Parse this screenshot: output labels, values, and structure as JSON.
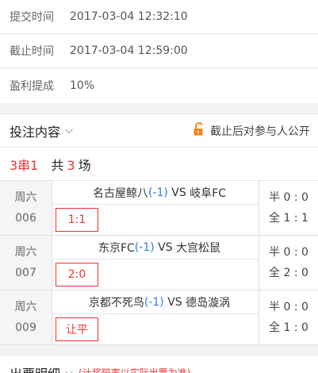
{
  "info": {
    "submit_label": "提交时间",
    "submit_value": "2017-03-04 12:32:10",
    "deadline_label": "截止时间",
    "deadline_value": "2017-03-04 12:59:00",
    "commission_label": "盈利提成",
    "commission_value": "10%"
  },
  "bet_section": {
    "title": "投注内容",
    "public_label": "截止后对参与人公开",
    "combo_type": "3串1",
    "total_prefix": "共",
    "total_count": "3",
    "total_suffix": "场"
  },
  "matches": [
    {
      "day": "周六",
      "num": "006",
      "home": "名古屋鲸八",
      "handicap": "(-1)",
      "vs": " VS ",
      "away": "岐阜FC",
      "pick": "1:1",
      "half": "半 0 : 0",
      "full": "全 1 : 1"
    },
    {
      "day": "周六",
      "num": "007",
      "home": "东京FC",
      "handicap": "(-1)",
      "vs": " VS ",
      "away": "大宫松鼠",
      "pick": "2:0",
      "half": "半 0 : 0",
      "full": "全 2 : 0"
    },
    {
      "day": "周六",
      "num": "009",
      "home": "京都不死鸟",
      "handicap": "(-1)",
      "vs": " VS ",
      "away": "德岛漩涡",
      "pick": "让平",
      "half": "半 0 : 0",
      "full": "全 1 : 0"
    }
  ],
  "ticket": {
    "title": "出票明细",
    "note": "(计奖赔率以实际出票为准)"
  },
  "colors": {
    "accent_red": "#e33333",
    "accent_blue": "#2b7de9",
    "lock_orange": "#f5821f"
  },
  "icons": {
    "dropdown": "chevron-down-icon",
    "lock": "unlock-icon"
  }
}
